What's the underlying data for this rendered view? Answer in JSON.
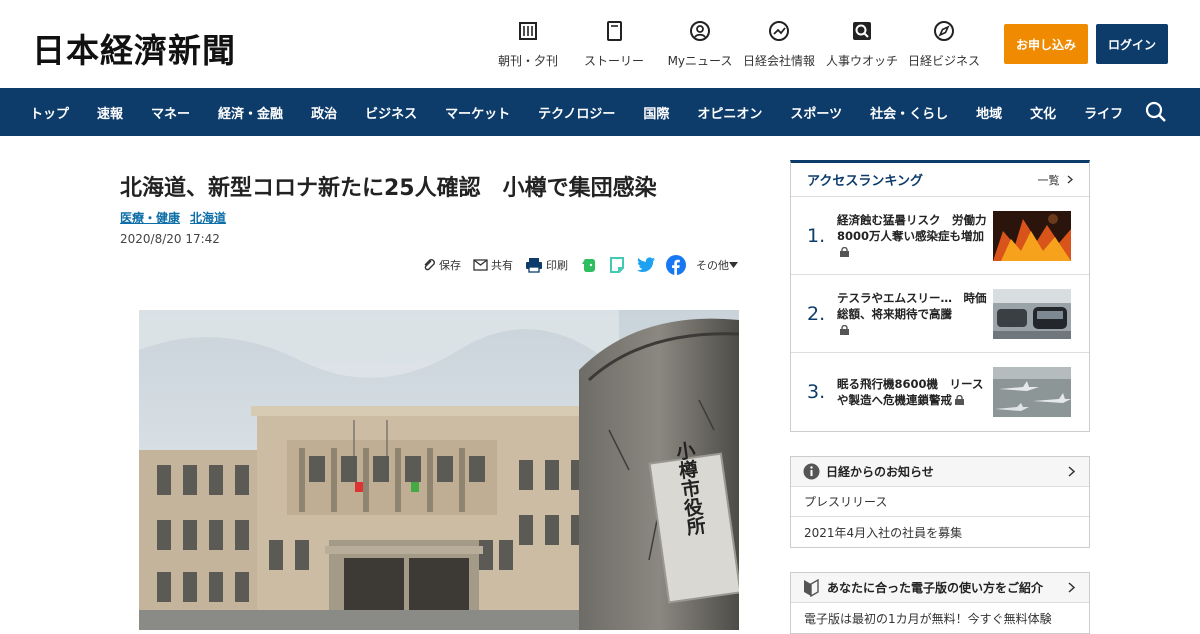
{
  "header": {
    "logo": "日本経濟新聞",
    "tools": [
      {
        "label": "朝刊・夕刊",
        "icon": "newspaper-grid-icon"
      },
      {
        "label": "ストーリー",
        "icon": "book-icon"
      },
      {
        "label": "Myニュース",
        "icon": "user-circle-icon"
      },
      {
        "label": "日経会社情報",
        "icon": "chart-line-icon"
      },
      {
        "label": "人事ウオッチ",
        "icon": "person-search-icon"
      },
      {
        "label": "日経ビジネス",
        "icon": "compass-icon"
      }
    ],
    "subscribe": "お申し込み",
    "login": "ログイン"
  },
  "nav": {
    "items": [
      "トップ",
      "速報",
      "マネー",
      "経済・金融",
      "政治",
      "ビジネス",
      "マーケット",
      "テクノロジー",
      "国際",
      "オピニオン",
      "スポーツ",
      "社会・くらし",
      "地域",
      "文化",
      "ライフ"
    ]
  },
  "article": {
    "title": "北海道、新型コロナ新たに25人確認　小樽で集団感染",
    "tags": [
      "医療・健康",
      "北海道"
    ],
    "date": "2020/8/20 17:42",
    "share": {
      "save": "保存",
      "share": "共有",
      "print": "印刷",
      "more": "その他"
    },
    "photo_sign": "小樽市役所"
  },
  "sidebar": {
    "ranking": {
      "title": "アクセスランキング",
      "more": "一覧",
      "items": [
        {
          "num": "1.",
          "text": "経済蝕む猛暑リスク　労働力8000万人奪い感染症も増加"
        },
        {
          "num": "2.",
          "text": "テスラやエムスリー…　時価総額、将来期待で高騰"
        },
        {
          "num": "3.",
          "text": "眠る飛行機8600機　リースや製造へ危機連鎖警戒"
        }
      ]
    },
    "notice": {
      "title": "日経からのお知らせ",
      "rows": [
        "プレスリリース",
        "2021年4月入社の社員を募集"
      ]
    },
    "guide": {
      "title": "あなたに合った電子版の使い方をご紹介",
      "rows": [
        "電子版は最初の1カ月が無料！今すぐ無料体験"
      ]
    }
  },
  "colors": {
    "navy": "#0d3c6b",
    "orange": "#f08a00",
    "link": "#0d6ea8"
  }
}
